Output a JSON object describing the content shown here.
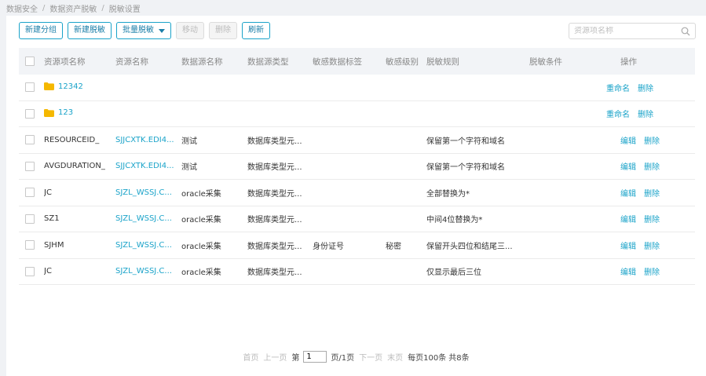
{
  "breadcrumb": [
    "数据安全",
    "数据资产脱敏",
    "脱敏设置"
  ],
  "toolbar": {
    "new_group": "新建分组",
    "new_mask": "新建脱敏",
    "batch_mask": "批量脱敏",
    "move": "移动",
    "delete": "删除",
    "refresh": "刷新"
  },
  "search": {
    "placeholder": "资源项名称"
  },
  "table": {
    "headers": [
      "资源项名称",
      "资源名称",
      "数据源名称",
      "数据源类型",
      "敏感数据标签",
      "敏感级别",
      "脱敏规则",
      "脱敏条件",
      "操作"
    ],
    "folders": [
      {
        "name": "12342",
        "op1": "重命名",
        "op2": "删除"
      },
      {
        "name": "123",
        "op1": "重命名",
        "op2": "删除"
      }
    ],
    "rows": [
      {
        "item": "RESOURCEID_",
        "resource": "SJJCXTK.EDI4...",
        "datasource": "测试",
        "dstype": "数据库类型元...",
        "tag": "",
        "level": "",
        "rule": "保留第一个字符和域名",
        "cond": "",
        "op1": "编辑",
        "op2": "删除"
      },
      {
        "item": "AVGDURATION_",
        "resource": "SJJCXTK.EDI4...",
        "datasource": "测试",
        "dstype": "数据库类型元...",
        "tag": "",
        "level": "",
        "rule": "保留第一个字符和域名",
        "cond": "",
        "op1": "编辑",
        "op2": "删除"
      },
      {
        "item": "JC",
        "resource": "SJZL_WSSJ.C...",
        "datasource": "oracle采集",
        "dstype": "数据库类型元...",
        "tag": "",
        "level": "",
        "rule": "全部替换为*",
        "cond": "",
        "op1": "编辑",
        "op2": "删除"
      },
      {
        "item": "SZ1",
        "resource": "SJZL_WSSJ.C...",
        "datasource": "oracle采集",
        "dstype": "数据库类型元...",
        "tag": "",
        "level": "",
        "rule": "中间4位替换为*",
        "cond": "",
        "op1": "编辑",
        "op2": "删除"
      },
      {
        "item": "SJHM",
        "resource": "SJZL_WSSJ.C...",
        "datasource": "oracle采集",
        "dstype": "数据库类型元...",
        "tag": "身份证号",
        "level": "秘密",
        "rule": "保留开头四位和结尾三...",
        "cond": "",
        "op1": "编辑",
        "op2": "删除"
      },
      {
        "item": "JC",
        "resource": "SJZL_WSSJ.C...",
        "datasource": "oracle采集",
        "dstype": "数据库类型元...",
        "tag": "",
        "level": "",
        "rule": "仅显示最后三位",
        "cond": "",
        "op1": "编辑",
        "op2": "删除"
      }
    ]
  },
  "pager": {
    "first": "首页",
    "prev": "上一页",
    "page_prefix": "第",
    "page_value": "1",
    "page_suffix": "页/1页",
    "next": "下一页",
    "last": "末页",
    "per_page": "每页100条",
    "total": "共8条"
  },
  "colors": {
    "accent": "#1aa3c9",
    "folder": "#f5b800",
    "header_bg": "#f2f4f7"
  }
}
